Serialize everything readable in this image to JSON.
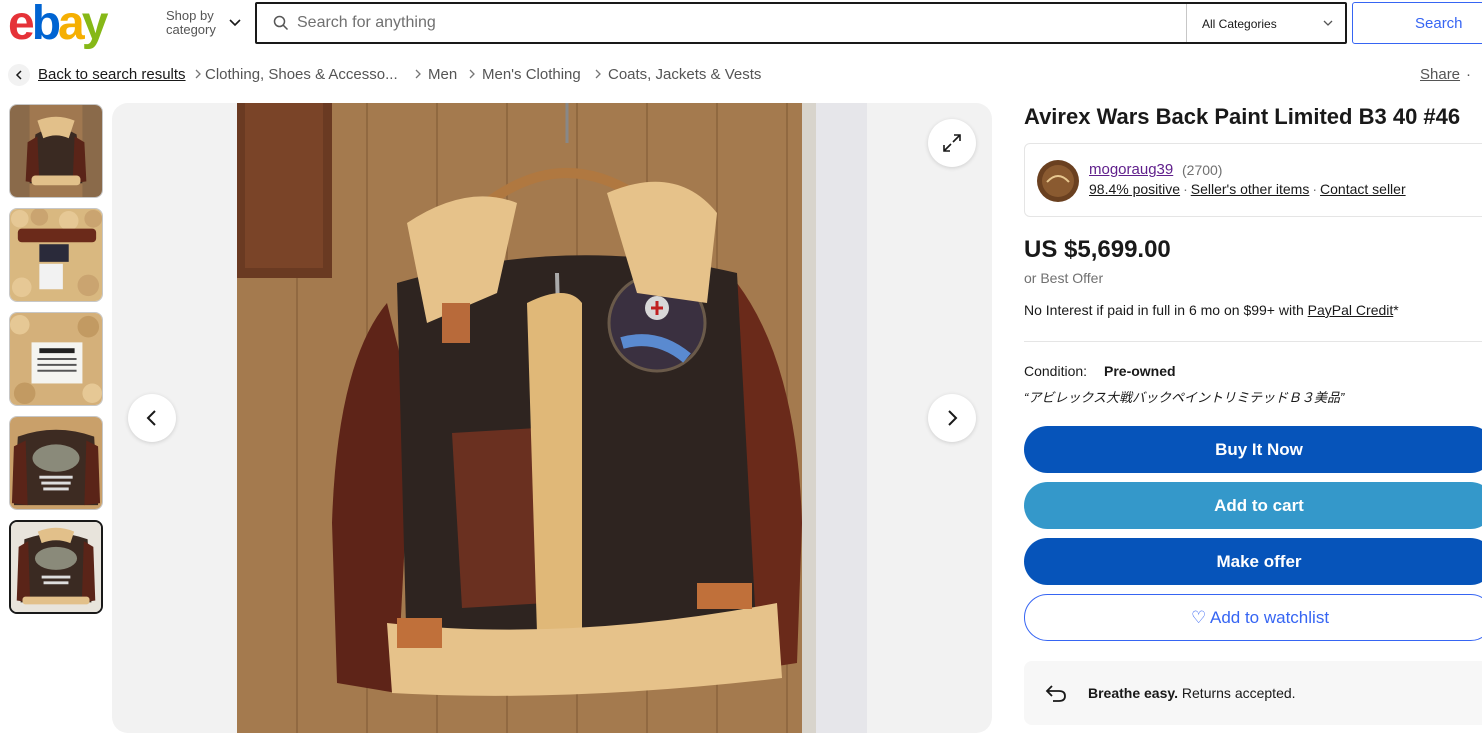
{
  "header": {
    "logo_letters": [
      "e",
      "b",
      "a",
      "y"
    ],
    "shop_by_label": "Shop by category",
    "search_placeholder": "Search for anything",
    "category_select": "All Categories",
    "search_button": "Search"
  },
  "breadcrumbs": {
    "back_label": "Back to search results",
    "items": [
      "Clothing, Shoes & Accesso...",
      "Men",
      "Men's Clothing",
      "Coats, Jackets & Vests"
    ],
    "share_label": "Share",
    "share_more": "·"
  },
  "gallery": {
    "thumbnail_count": 5,
    "selected_index": 4
  },
  "listing": {
    "title": "Avirex Wars Back Paint Limited B3 40 #46",
    "seller": {
      "name": "mogoraug39",
      "feedback_count": "(2700)",
      "positive": "98.4% positive",
      "other_items": "Seller's other items",
      "contact": "Contact seller"
    },
    "price": "US $5,699.00",
    "best_offer": "or Best Offer",
    "credit_text": "No Interest if paid in full in 6 mo on $99+ with ",
    "credit_link": "PayPal Credit",
    "credit_suffix": "*",
    "condition_label": "Condition:",
    "condition_value": "Pre-owned",
    "condition_description": "“アビレックス大戦バックペイントリミテッドＢ３美品”",
    "buttons": {
      "buy_now": "Buy It Now",
      "add_to_cart": "Add to cart",
      "make_offer": "Make offer",
      "watchlist": "♡ Add to watchlist"
    },
    "returns": {
      "bold": "Breathe easy.",
      "text": " Returns accepted."
    }
  },
  "colors": {
    "buy_now": "#0654ba",
    "add_to_cart": "#3498ca",
    "accent": "#3665f3",
    "seller_link": "#5f1e8b"
  }
}
